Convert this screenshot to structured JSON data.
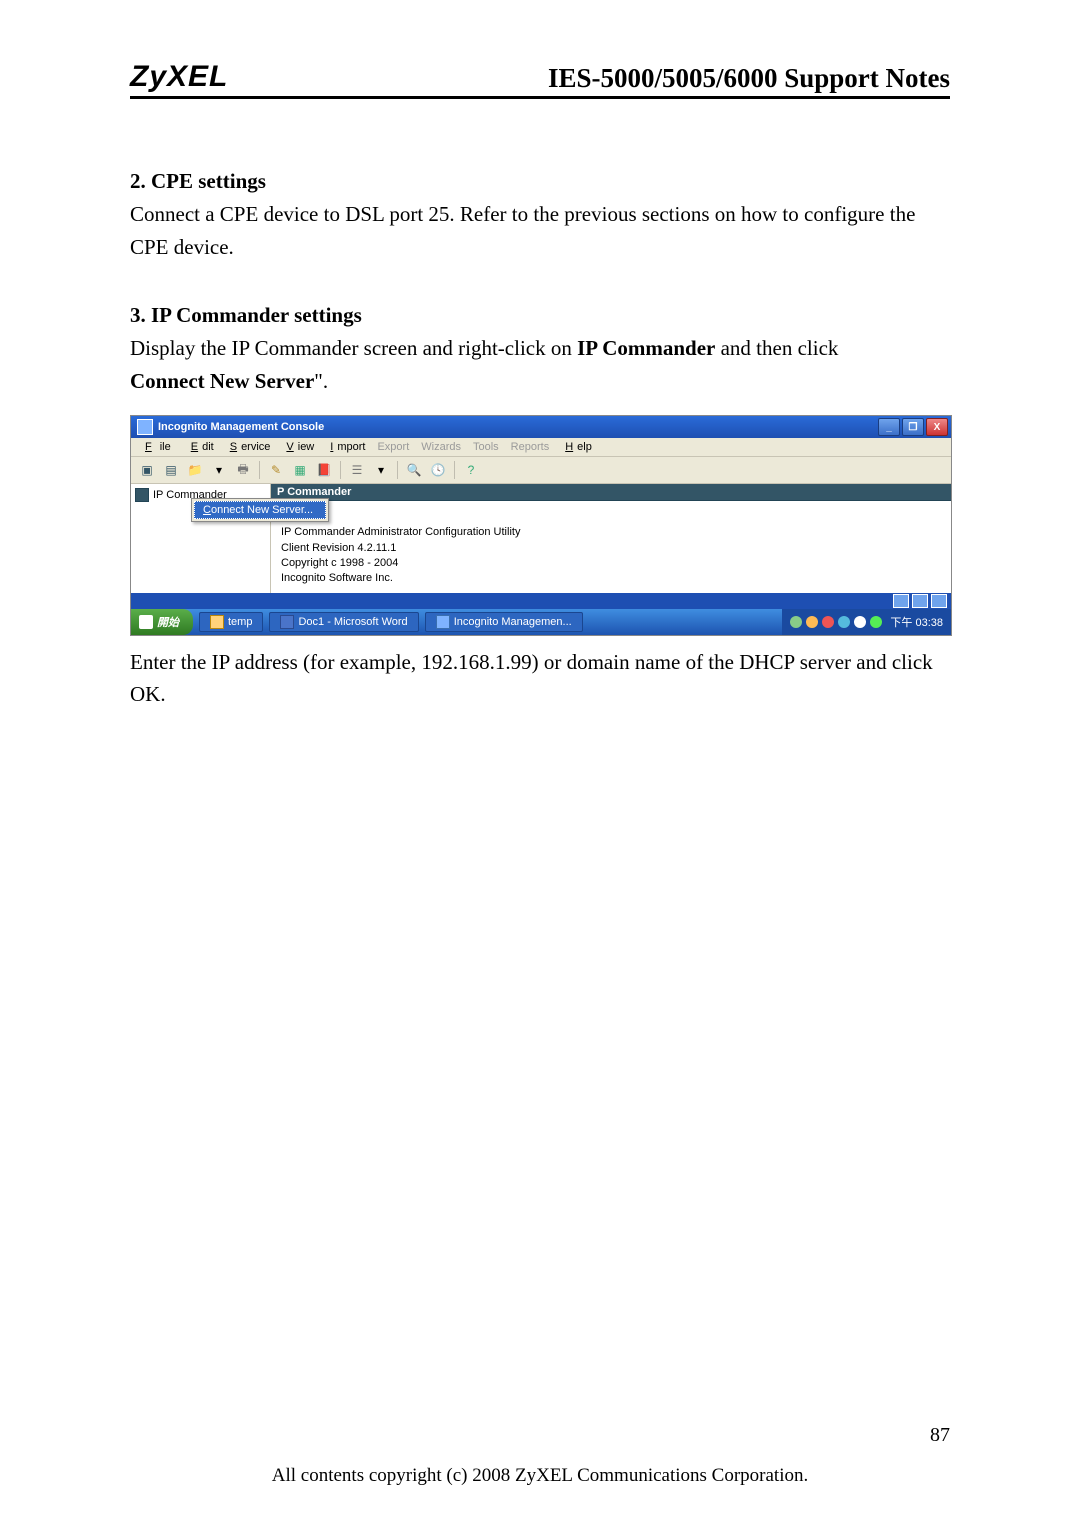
{
  "header": {
    "logo": "ZyXEL",
    "doc_title": "IES-5000/5005/6000 Support Notes"
  },
  "section2": {
    "heading": "2. CPE settings",
    "para": "Connect a CPE device to DSL port 25. Refer to the previous sections on how to configure the CPE device."
  },
  "section3": {
    "heading": "3. IP Commander settings",
    "para_pre": "Display the IP Commander screen and right-click on ",
    "para_bold1": "IP Commander",
    "para_mid": " and then click ",
    "para_bold2": "Connect New Server",
    "para_post": "\"."
  },
  "screenshot": {
    "titlebar": "Incognito Management Console",
    "win_min": "_",
    "win_max": "❐",
    "win_close": "X",
    "menus": {
      "file": "File",
      "edit": "Edit",
      "service": "Service",
      "view": "View",
      "import": "Import",
      "export": "Export",
      "wizards": "Wizards",
      "tools": "Tools",
      "reports": "Reports",
      "help": "Help"
    },
    "tree_label": "IP Commander",
    "context_menu_item": "Connect New Server...",
    "detail_header": "P Commander",
    "detail_line1": "IP Commander Administrator Configuration Utility",
    "detail_line2": "Client Revision 4.2.11.1",
    "detail_line3": "Copyright c 1998 - 2004",
    "detail_line4": "Incognito Software Inc.",
    "taskbar": {
      "start": "開始",
      "item1": "temp",
      "item2": "Doc1 - Microsoft Word",
      "item3": "Incognito Managemen...",
      "clock": "下午 03:38"
    }
  },
  "after": "Enter the IP address (for example, 192.168.1.99) or domain name of the DHCP server and click OK.",
  "page_number": "87",
  "copyright": "All contents copyright (c) 2008 ZyXEL Communications Corporation."
}
